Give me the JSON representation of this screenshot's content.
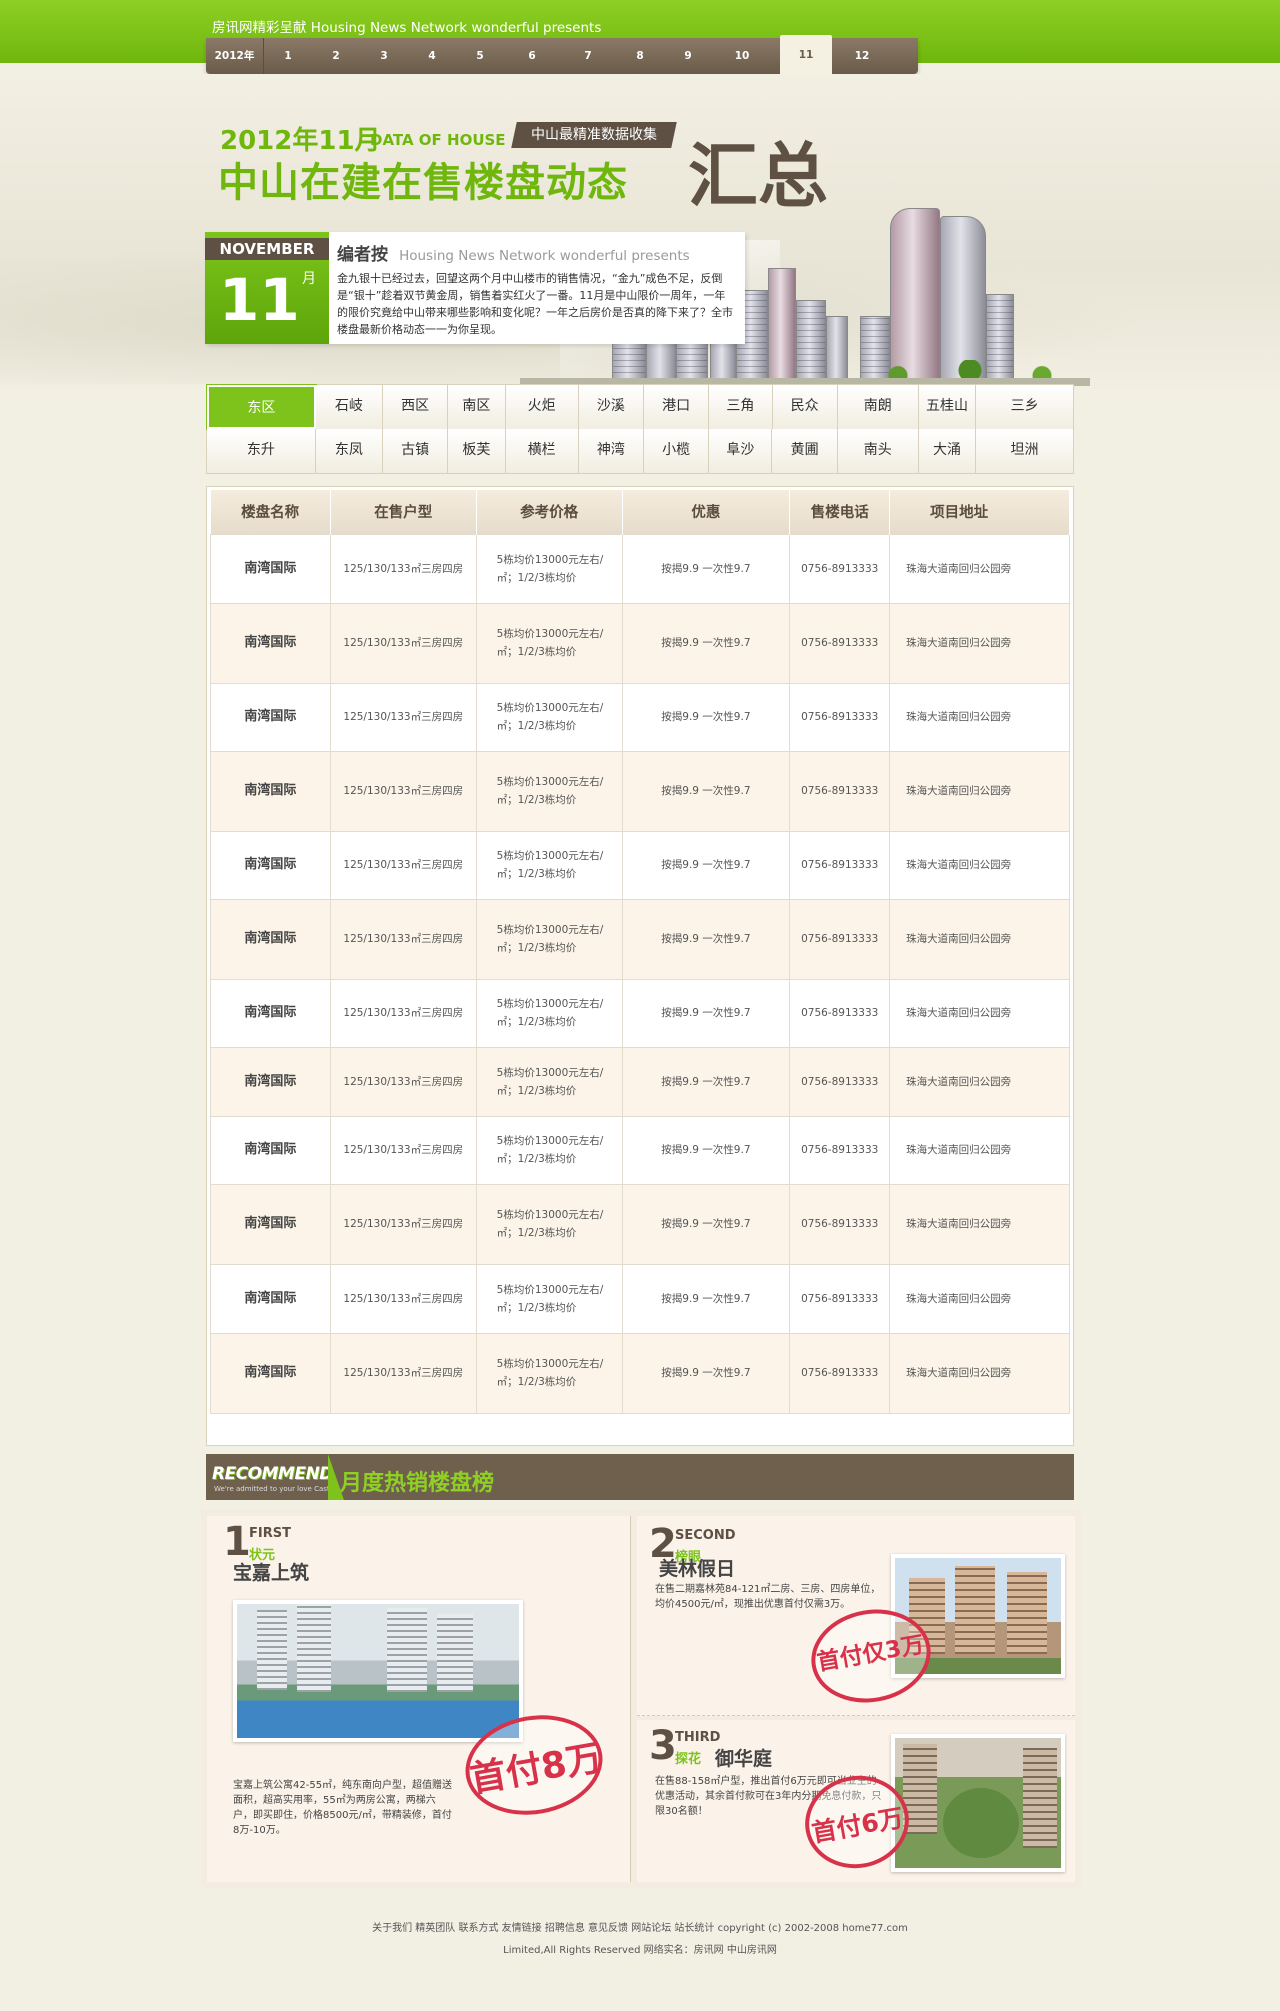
{
  "header": {
    "slogan": "房讯网精彩呈献 Housing News Network wonderful presents",
    "year_label": "2012年",
    "months": [
      "1",
      "2",
      "3",
      "4",
      "5",
      "6",
      "7",
      "8",
      "9",
      "10",
      "11",
      "12"
    ],
    "active_month": "11"
  },
  "hero": {
    "date_title": "2012年11月",
    "data_of_house": "DATA OF HOUSE",
    "tag": "中山最精准数据收集",
    "main_title": "中山在建在售楼盘动态",
    "sum_title": "汇总",
    "month_en": "NOVEMBER",
    "day": "11",
    "day_unit": "月",
    "editor_title": "编者按",
    "editor_subtitle": "Housing News Network wonderful presents",
    "editor_text": "金九银十已经过去，回望这两个月中山楼市的销售情况，“金九”成色不足，反倒是“银十”趁着双节黄金周，销售着实红火了一番。11月是中山限价一周年，一年的限价究竟给中山带来哪些影响和变化呢？一年之后房价是否真的降下来了？全市楼盘最新价格动态一一为你呈现。"
  },
  "districts": {
    "row1": [
      "东区",
      "石岐",
      "西区",
      "南区",
      "火炬",
      "沙溪",
      "港口",
      "三角",
      "民众",
      "南朗",
      "五桂山",
      "三乡"
    ],
    "row2": [
      "东升",
      "东凤",
      "古镇",
      "板芙",
      "横栏",
      "神湾",
      "小榄",
      "阜沙",
      "黄圃",
      "南头",
      "大涌",
      "坦洲"
    ],
    "active": "东区"
  },
  "table": {
    "headers": [
      "楼盘名称",
      "在售户型",
      "参考价格",
      "优惠",
      "售楼电话",
      "项目地址"
    ],
    "rows": [
      {
        "name": "南湾国际",
        "type": "125/130/133㎡三房四房",
        "price": "5栋均价13000元左右/㎡；1/2/3栋均价",
        "discount": "按揭9.9 一次性9.7",
        "phone": "0756-8913333",
        "address": "珠海大道南回归公园旁"
      },
      {
        "name": "南湾国际",
        "type": "125/130/133㎡三房四房",
        "price": "5栋均价13000元左右/㎡；1/2/3栋均价",
        "discount": "按揭9.9 一次性9.7",
        "phone": "0756-8913333",
        "address": "珠海大道南回归公园旁"
      },
      {
        "name": "南湾国际",
        "type": "125/130/133㎡三房四房",
        "price": "5栋均价13000元左右/㎡；1/2/3栋均价",
        "discount": "按揭9.9 一次性9.7",
        "phone": "0756-8913333",
        "address": "珠海大道南回归公园旁"
      },
      {
        "name": "南湾国际",
        "type": "125/130/133㎡三房四房",
        "price": "5栋均价13000元左右/㎡；1/2/3栋均价",
        "discount": "按揭9.9 一次性9.7",
        "phone": "0756-8913333",
        "address": "珠海大道南回归公园旁"
      },
      {
        "name": "南湾国际",
        "type": "125/130/133㎡三房四房",
        "price": "5栋均价13000元左右/㎡；1/2/3栋均价",
        "discount": "按揭9.9 一次性9.7",
        "phone": "0756-8913333",
        "address": "珠海大道南回归公园旁"
      },
      {
        "name": "南湾国际",
        "type": "125/130/133㎡三房四房",
        "price": "5栋均价13000元左右/㎡；1/2/3栋均价",
        "discount": "按揭9.9 一次性9.7",
        "phone": "0756-8913333",
        "address": "珠海大道南回归公园旁"
      },
      {
        "name": "南湾国际",
        "type": "125/130/133㎡三房四房",
        "price": "5栋均价13000元左右/㎡；1/2/3栋均价",
        "discount": "按揭9.9 一次性9.7",
        "phone": "0756-8913333",
        "address": "珠海大道南回归公园旁"
      },
      {
        "name": "南湾国际",
        "type": "125/130/133㎡三房四房",
        "price": "5栋均价13000元左右/㎡；1/2/3栋均价",
        "discount": "按揭9.9 一次性9.7",
        "phone": "0756-8913333",
        "address": "珠海大道南回归公园旁"
      },
      {
        "name": "南湾国际",
        "type": "125/130/133㎡三房四房",
        "price": "5栋均价13000元左右/㎡；1/2/3栋均价",
        "discount": "按揭9.9 一次性9.7",
        "phone": "0756-8913333",
        "address": "珠海大道南回归公园旁"
      },
      {
        "name": "南湾国际",
        "type": "125/130/133㎡三房四房",
        "price": "5栋均价13000元左右/㎡；1/2/3栋均价",
        "discount": "按揭9.9 一次性9.7",
        "phone": "0756-8913333",
        "address": "珠海大道南回归公园旁"
      },
      {
        "name": "南湾国际",
        "type": "125/130/133㎡三房四房",
        "price": "5栋均价13000元左右/㎡；1/2/3栋均价",
        "discount": "按揭9.9 一次性9.7",
        "phone": "0756-8913333",
        "address": "珠海大道南回归公园旁"
      },
      {
        "name": "南湾国际",
        "type": "125/130/133㎡三房四房",
        "price": "5栋均价13000元左右/㎡；1/2/3栋均价",
        "discount": "按揭9.9 一次性9.7",
        "phone": "0756-8913333",
        "address": "珠海大道南回归公园旁"
      }
    ]
  },
  "recommend": {
    "en": "RECOMMEND",
    "en_sub": "We're admitted to your love Castle",
    "title": "月度热销楼盘榜",
    "first": {
      "rank": "1",
      "rank_en": "FIRST",
      "tag": "状元",
      "name": "宝嘉上筑",
      "desc": "宝嘉上筑公寓42-55㎡，纯东南向户型，超值赠送面积，超高实用率，55㎡为两房公寓，两梯六户，即买即住，价格8500元/㎡，带精装修，首付8万-10万。",
      "stamp": "首付8万"
    },
    "second": {
      "rank": "2",
      "rank_en": "SECOND",
      "tag": "榜眼",
      "name": "美林假日",
      "desc": "在售二期嘉林苑84-121㎡二房、三房、四房单位，均价4500元/㎡，现推出优惠首付仅需3万。",
      "stamp": "首付仅3万"
    },
    "third": {
      "rank": "3",
      "rank_en": "THIRD",
      "tag": "探花",
      "name": "御华庭",
      "desc": "在售88-158㎡户型，推出首付6万元即可当业主的优惠活动，其余首付款可在3年内分期免息付款，只限30名额！",
      "stamp": "首付6万"
    }
  },
  "footer": {
    "links": [
      "关于我们",
      "精英团队",
      "联系方式",
      "友情链接",
      "招聘信息",
      "意见反馈",
      "网站论坛",
      "站长统计"
    ],
    "copyright": "copyright (c) 2002-2008 home77.com",
    "line2": "Limited,All Rights Reserved 网络实名：房讯网 中山房讯网"
  }
}
